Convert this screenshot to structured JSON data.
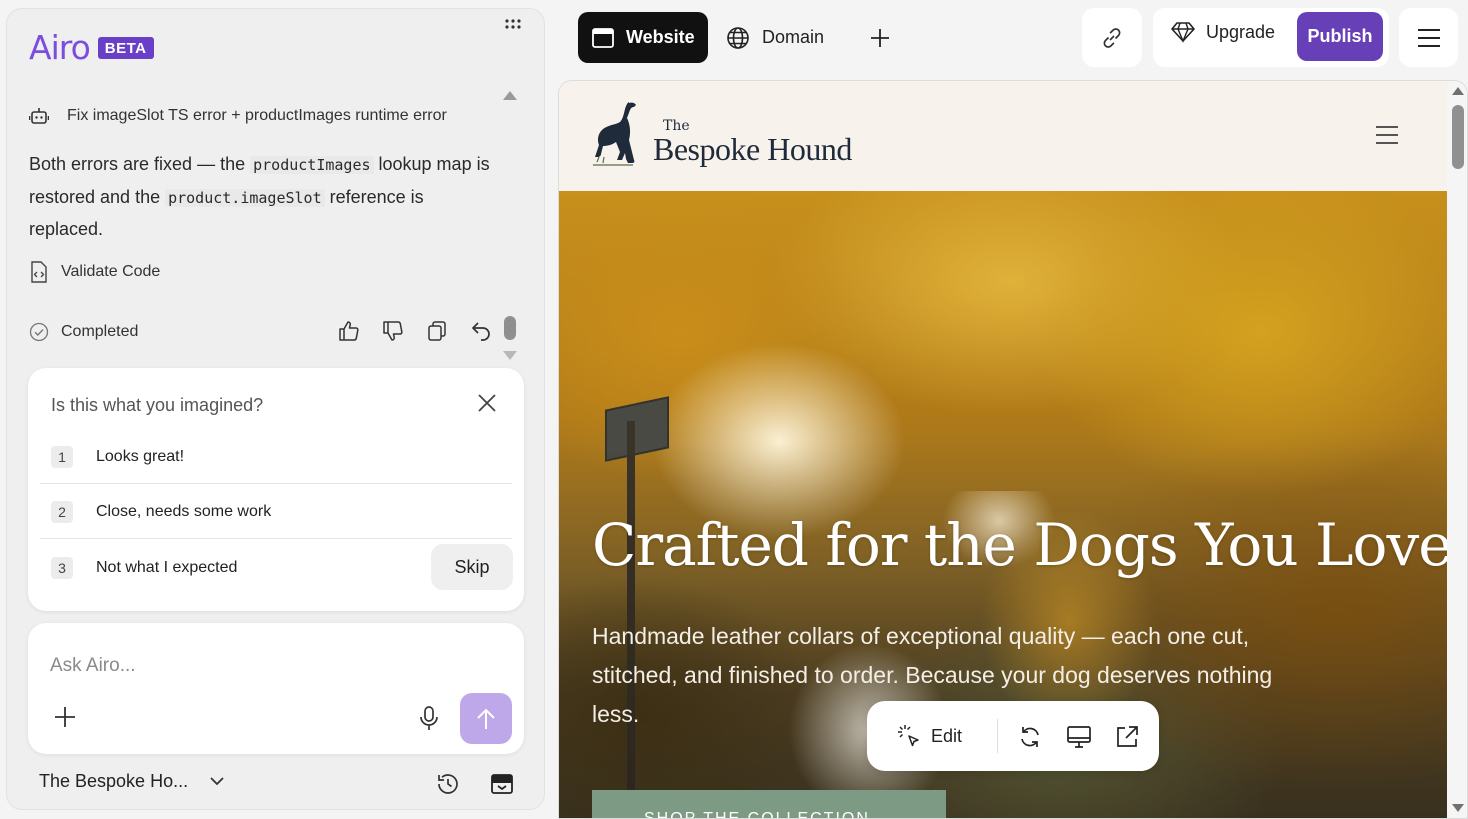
{
  "app": {
    "logo": "Airo",
    "badge": "BETA"
  },
  "chat": {
    "task_title": "Fix imageSlot TS error + productImages runtime error",
    "message": {
      "part1": "Both errors are fixed — the ",
      "code1": "productImages",
      "part2": " lookup map is restored and the ",
      "code2": "product.imageSlot",
      "part3": " reference is replaced."
    },
    "validate_label": "Validate Code",
    "status_label": "Completed"
  },
  "feedback": {
    "title": "Is this what you imagined?",
    "options": [
      {
        "num": "1",
        "label": "Looks great!"
      },
      {
        "num": "2",
        "label": "Close, needs some work"
      },
      {
        "num": "3",
        "label": "Not what I expected"
      }
    ],
    "skip_label": "Skip"
  },
  "composer": {
    "placeholder": "Ask Airo..."
  },
  "bottom": {
    "project_name": "The Bespoke Ho..."
  },
  "topbar": {
    "tab_website": "Website",
    "tab_domain": "Domain",
    "upgrade_label": "Upgrade",
    "publish_label": "Publish"
  },
  "preview": {
    "logo_the": "The",
    "logo_name": "Bespoke Hound",
    "hero_title": "Crafted for the Dogs You Love",
    "hero_subtitle": "Handmade leather collars of exceptional quality — each one cut, stitched, and finished to order. Because your dog deserves nothing less.",
    "cta_label": "SHOP THE COLLECTION"
  },
  "edit_toolbar": {
    "edit_label": "Edit"
  },
  "colors": {
    "brand": "#7b4ee0",
    "publish": "#673fb6",
    "send_button": "#bea8ea",
    "cta": "#7d9a84"
  }
}
